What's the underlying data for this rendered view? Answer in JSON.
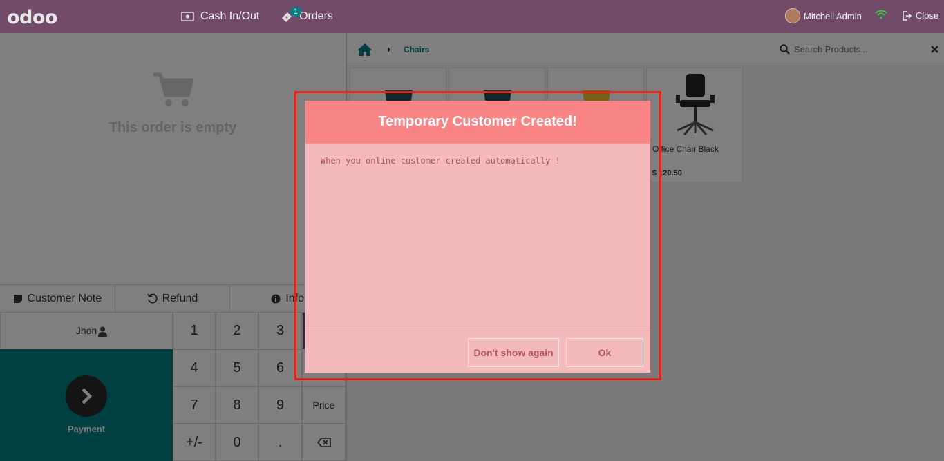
{
  "topbar": {
    "logo": "odoo",
    "cash_label": "Cash In/Out",
    "orders_label": "Orders",
    "orders_badge": "1",
    "user_name": "Mitchell Admin",
    "close_label": "Close"
  },
  "order": {
    "empty_text": "This order is empty"
  },
  "controls": {
    "customer_note": "Customer Note",
    "refund": "Refund",
    "info": "Info"
  },
  "pad": {
    "customer": "Jhon",
    "payment": "Payment",
    "keys": [
      "1",
      "2",
      "3",
      "",
      "4",
      "5",
      "6",
      "",
      "7",
      "8",
      "9",
      "Price",
      "+/-",
      "0",
      ".",
      ""
    ]
  },
  "breadcrumb": {
    "category": "Chairs"
  },
  "search": {
    "placeholder": "Search Products..."
  },
  "products": [
    {
      "name": "",
      "price": "",
      "color": "#1f4e5a"
    },
    {
      "name": "",
      "price": "",
      "color": "#1f4e5a"
    },
    {
      "name": "",
      "price": "",
      "color": "#e6c229"
    },
    {
      "name": "Office Chair Black",
      "price": "$ 120.50",
      "color": "#222222"
    }
  ],
  "dialog": {
    "title": "Temporary Customer Created!",
    "message": "When you online customer created automatically !",
    "dont_show": "Don't show again",
    "ok": "Ok"
  },
  "colors": {
    "brand": "#714b67",
    "teal": "#017e84",
    "dialog_header": "#f98485",
    "highlight": "#e2231a"
  }
}
